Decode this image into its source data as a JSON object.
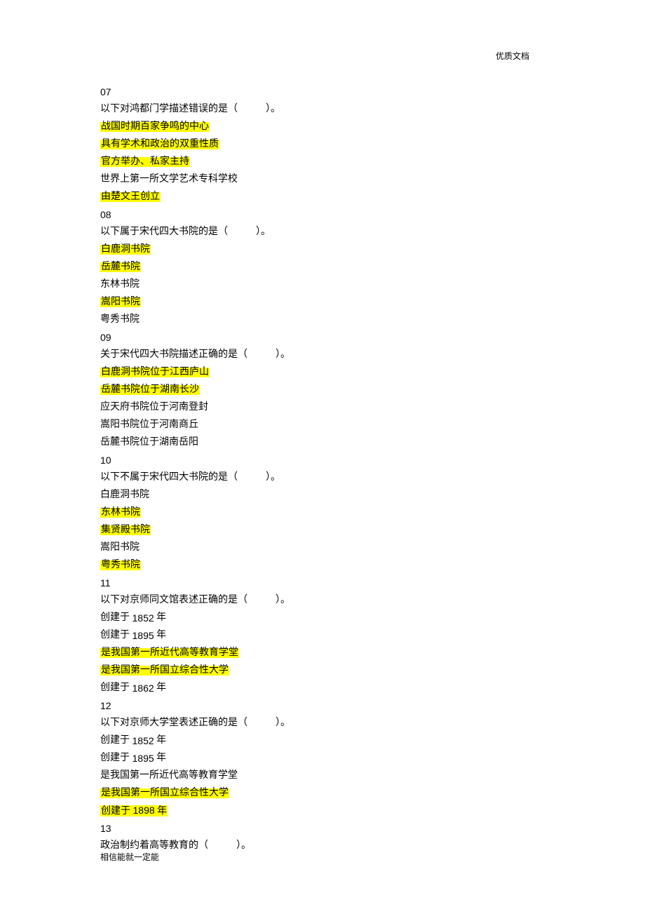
{
  "header": "优质文档",
  "footer": "相信能就一定能",
  "questions": [
    {
      "num": "07",
      "stem_pre": "以下对鸿都门学描述错误的是（",
      "stem_post": "）。",
      "options": [
        {
          "text": "战国时期百家争鸣的中心",
          "hl": true
        },
        {
          "text": "具有学术和政治的双重性质",
          "hl": true
        },
        {
          "text": "官方举办、私家主持",
          "hl": true
        },
        {
          "text": "世界上第一所文学艺术专科学校",
          "hl": false
        },
        {
          "text": "由楚文王创立",
          "hl": true
        }
      ]
    },
    {
      "num": "08",
      "stem_pre": "以下属于宋代四大书院的是（",
      "stem_post": "）。",
      "options": [
        {
          "text": "白鹿洞书院",
          "hl": true
        },
        {
          "text": "岳麓书院",
          "hl": true
        },
        {
          "text": "东林书院",
          "hl": false
        },
        {
          "text": "嵩阳书院",
          "hl": true
        },
        {
          "text": "粤秀书院",
          "hl": false
        }
      ]
    },
    {
      "num": "09",
      "stem_pre": "关于宋代四大书院描述正确的是（",
      "stem_post": "）。",
      "options": [
        {
          "text": "白鹿洞书院位于江西庐山",
          "hl": true
        },
        {
          "text": "岳麓书院位于湖南长沙",
          "hl": true
        },
        {
          "text": "应天府书院位于河南登封",
          "hl": false
        },
        {
          "text": "嵩阳书院位于河南商丘",
          "hl": false
        },
        {
          "text": "岳麓书院位于湖南岳阳",
          "hl": false
        }
      ]
    },
    {
      "num": "10",
      "stem_pre": "以下不属于宋代四大书院的是（",
      "stem_post": "）。",
      "options": [
        {
          "text": "白鹿洞书院",
          "hl": false
        },
        {
          "text": "东林书院",
          "hl": true
        },
        {
          "text": "集贤殿书院",
          "hl": true
        },
        {
          "text": "嵩阳书院",
          "hl": false
        },
        {
          "text": "粤秀书院",
          "hl": true
        }
      ]
    },
    {
      "num": "11",
      "stem_pre": "以下对京师同文馆表述正确的是（",
      "stem_post": "）。",
      "options": [
        {
          "parts": [
            {
              "t": "创建于 ",
              "hl": false,
              "arial": false
            },
            {
              "t": "1852",
              "hl": false,
              "arial": true
            },
            {
              "t": " 年",
              "hl": false,
              "arial": false
            }
          ]
        },
        {
          "parts": [
            {
              "t": "创建于 ",
              "hl": false,
              "arial": false
            },
            {
              "t": "1895",
              "hl": false,
              "arial": true
            },
            {
              "t": " 年",
              "hl": false,
              "arial": false
            }
          ]
        },
        {
          "text": "是我国第一所近代高等教育学堂",
          "hl": true
        },
        {
          "text": "是我国第一所国立综合性大学",
          "hl": true
        },
        {
          "parts": [
            {
              "t": "创建于 ",
              "hl": false,
              "arial": false
            },
            {
              "t": "1862",
              "hl": false,
              "arial": true
            },
            {
              "t": " 年",
              "hl": false,
              "arial": false
            }
          ]
        }
      ]
    },
    {
      "num": "12",
      "stem_pre": "以下对京师大学堂表述正确的是（",
      "stem_post": "）。",
      "options": [
        {
          "parts": [
            {
              "t": "创建于 ",
              "hl": false,
              "arial": false
            },
            {
              "t": "1852",
              "hl": false,
              "arial": true
            },
            {
              "t": " 年",
              "hl": false,
              "arial": false
            }
          ]
        },
        {
          "parts": [
            {
              "t": "创建于 ",
              "hl": false,
              "arial": false
            },
            {
              "t": "1895",
              "hl": false,
              "arial": true
            },
            {
              "t": " 年",
              "hl": false,
              "arial": false
            }
          ]
        },
        {
          "text": "是我国第一所近代高等教育学堂",
          "hl": false
        },
        {
          "text": "是我国第一所国立综合性大学",
          "hl": true
        },
        {
          "parts": [
            {
              "t": "创建于 ",
              "hl": true,
              "arial": false
            },
            {
              "t": "1898",
              "hl": true,
              "arial": true
            },
            {
              "t": " 年",
              "hl": true,
              "arial": false
            }
          ]
        }
      ]
    },
    {
      "num": "13",
      "stem_pre": "政治制约着高等教育的（",
      "stem_post": "）。",
      "options": []
    }
  ]
}
